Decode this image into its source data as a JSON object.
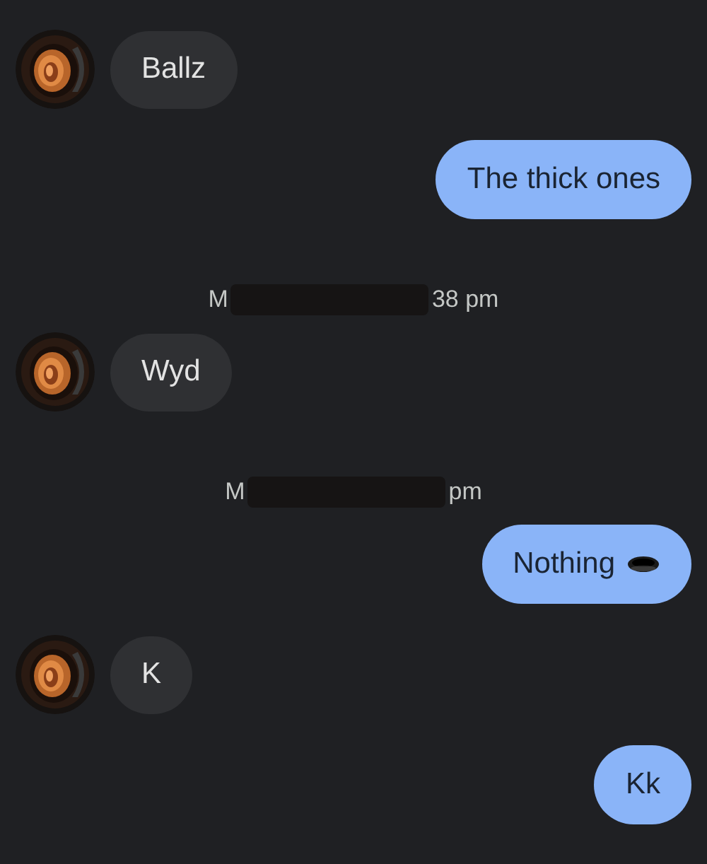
{
  "messages": [
    {
      "kind": "incoming",
      "text": "Ballz",
      "avatar": true
    },
    {
      "kind": "outgoing",
      "text": "The thick ones"
    },
    {
      "kind": "timestamp",
      "visible_start": "M",
      "visible_end": "38 pm"
    },
    {
      "kind": "incoming",
      "text": "Wyd",
      "avatar": true
    },
    {
      "kind": "timestamp",
      "visible_start": "M",
      "visible_end": "pm"
    },
    {
      "kind": "outgoing",
      "text": "Nothing",
      "emoji": true
    },
    {
      "kind": "incoming",
      "text": "K",
      "avatar": true
    },
    {
      "kind": "outgoing",
      "text": "Kk"
    }
  ]
}
